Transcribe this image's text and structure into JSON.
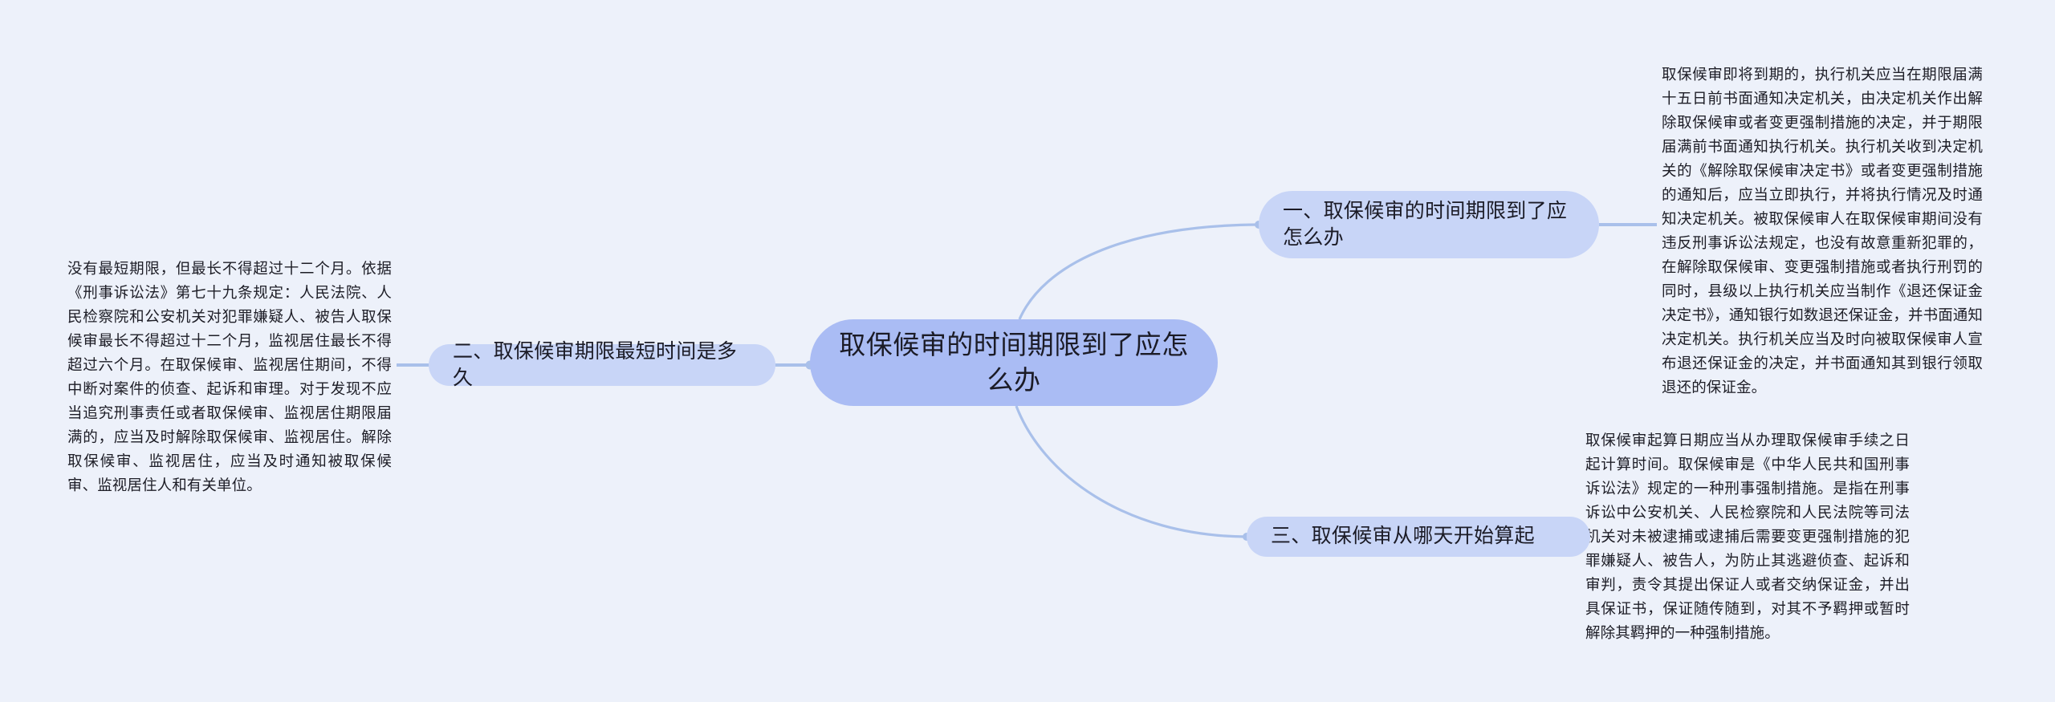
{
  "mindmap": {
    "background_color": "#edf1fa",
    "root_color": "#aabcf4",
    "branch_color": "#c8d5f7",
    "edge_color": "#a9c0ea",
    "text_color": "#1d1d26",
    "root": {
      "label": "取保候审的时间期限到了应怎么办"
    },
    "branches": [
      {
        "label": "一、取保候审的时间期限到了应怎么办",
        "detail": "取保候审即将到期的，执行机关应当在期限届满十五日前书面通知决定机关，由决定机关作出解除取保候审或者变更强制措施的决定，并于期限届满前书面通知执行机关。执行机关收到决定机关的《解除取保候审决定书》或者变更强制措施的通知后，应当立即执行，并将执行情况及时通知决定机关。被取保候审人在取保候审期间没有违反刑事诉讼法规定，也没有故意重新犯罪的，在解除取保候审、变更强制措施或者执行刑罚的同时，县级以上执行机关应当制作《退还保证金决定书》，通知银行如数退还保证金，并书面通知决定机关。执行机关应当及时向被取保候审人宣布退还保证金的决定，并书面通知其到银行领取退还的保证金。"
      },
      {
        "label": "二、取保候审期限最短时间是多久",
        "detail": "没有最短期限，但最长不得超过十二个月。依据《刑事诉讼法》第七十九条规定：人民法院、人民检察院和公安机关对犯罪嫌疑人、被告人取保候审最长不得超过十二个月，监视居住最长不得超过六个月。在取保候审、监视居住期间，不得中断对案件的侦查、起诉和审理。对于发现不应当追究刑事责任或者取保候审、监视居住期限届满的，应当及时解除取保候审、监视居住。解除取保候审、监视居住，应当及时通知被取保候审、监视居住人和有关单位。"
      },
      {
        "label": "三、取保候审从哪天开始算起",
        "detail": "取保候审起算日期应当从办理取保候审手续之日起计算时间。取保候审是《中华人民共和国刑事诉讼法》规定的一种刑事强制措施。是指在刑事诉讼中公安机关、人民检察院和人民法院等司法机关对未被逮捕或逮捕后需要变更强制措施的犯罪嫌疑人、被告人，为防止其逃避侦查、起诉和审判，责令其提出保证人或者交纳保证金，并出具保证书，保证随传随到，对其不予羁押或暂时解除其羁押的一种强制措施。"
      }
    ]
  }
}
